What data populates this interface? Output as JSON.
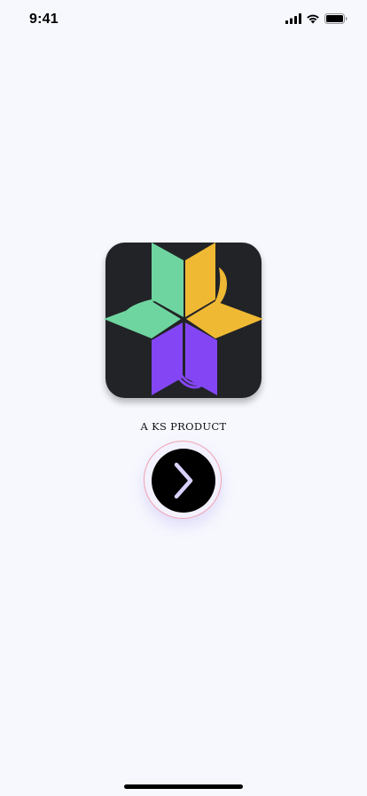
{
  "status_bar": {
    "time": "9:41",
    "icons": [
      "signal-icon",
      "wifi-icon",
      "battery-icon"
    ]
  },
  "logo": {
    "icon": "ks-flower-logo-icon",
    "colors": {
      "background": "#222327",
      "green": "#6fd5a0",
      "yellow": "#f0b934",
      "purple": "#8446f5"
    }
  },
  "tagline": "A KS PRODUCT",
  "next_button": {
    "icon": "chevron-right-icon",
    "ring_color": "#f1a3b1"
  },
  "colors": {
    "page_background": "#f7f8fe"
  }
}
